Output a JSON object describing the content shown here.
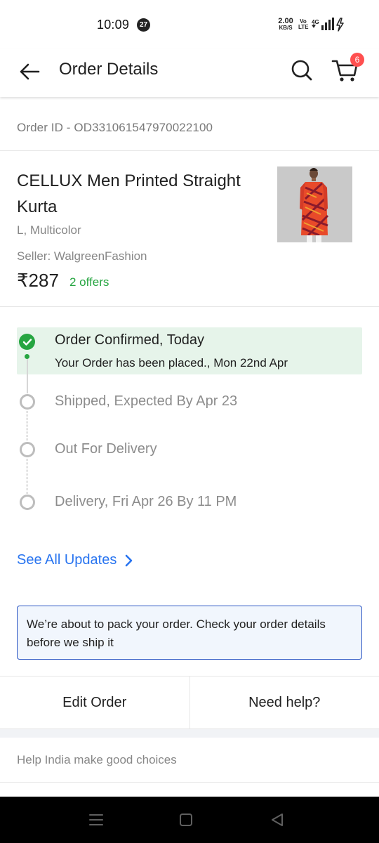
{
  "status_bar": {
    "time": "10:09",
    "notification_count": "27",
    "net_speed_value": "2.00",
    "net_speed_unit": "KB/S",
    "volte_line1": "Vo",
    "volte_line2": "LTE",
    "network_type": "4G"
  },
  "app_bar": {
    "title": "Order Details",
    "cart_count": "6",
    "icons": [
      "back-arrow-icon",
      "search-icon",
      "cart-icon"
    ]
  },
  "order": {
    "id_text": "Order ID - OD331061547970022100"
  },
  "product": {
    "title": "CELLUX Men Printed Straight Kurta",
    "variant": "L, Multicolor",
    "seller": "Seller: WalgreenFashion",
    "price": "₹287",
    "offers": "2 offers"
  },
  "timeline": {
    "steps": [
      {
        "title": "Order Confirmed, Today",
        "subtitle": "Your Order has been placed., Mon 22nd Apr",
        "status": "done"
      },
      {
        "title": "Shipped, Expected By Apr 23",
        "status": "pending"
      },
      {
        "title": "Out For Delivery",
        "status": "pending"
      },
      {
        "title": "Delivery, Fri Apr 26 By 11 PM",
        "status": "pending"
      }
    ],
    "see_all_label": "See All Updates"
  },
  "notice": {
    "text": "We’re about to pack your order. Check your order details before we ship it"
  },
  "actions": {
    "edit_label": "Edit Order",
    "help_label": "Need help?"
  },
  "footer": {
    "help_india_text": "Help India make good choices"
  },
  "colors": {
    "accent_blue": "#2874f0",
    "success_green": "#26a541",
    "confirmed_bg": "#e6f4ea",
    "notice_border": "#2a55c3",
    "cart_badge": "#ff4f4f"
  }
}
